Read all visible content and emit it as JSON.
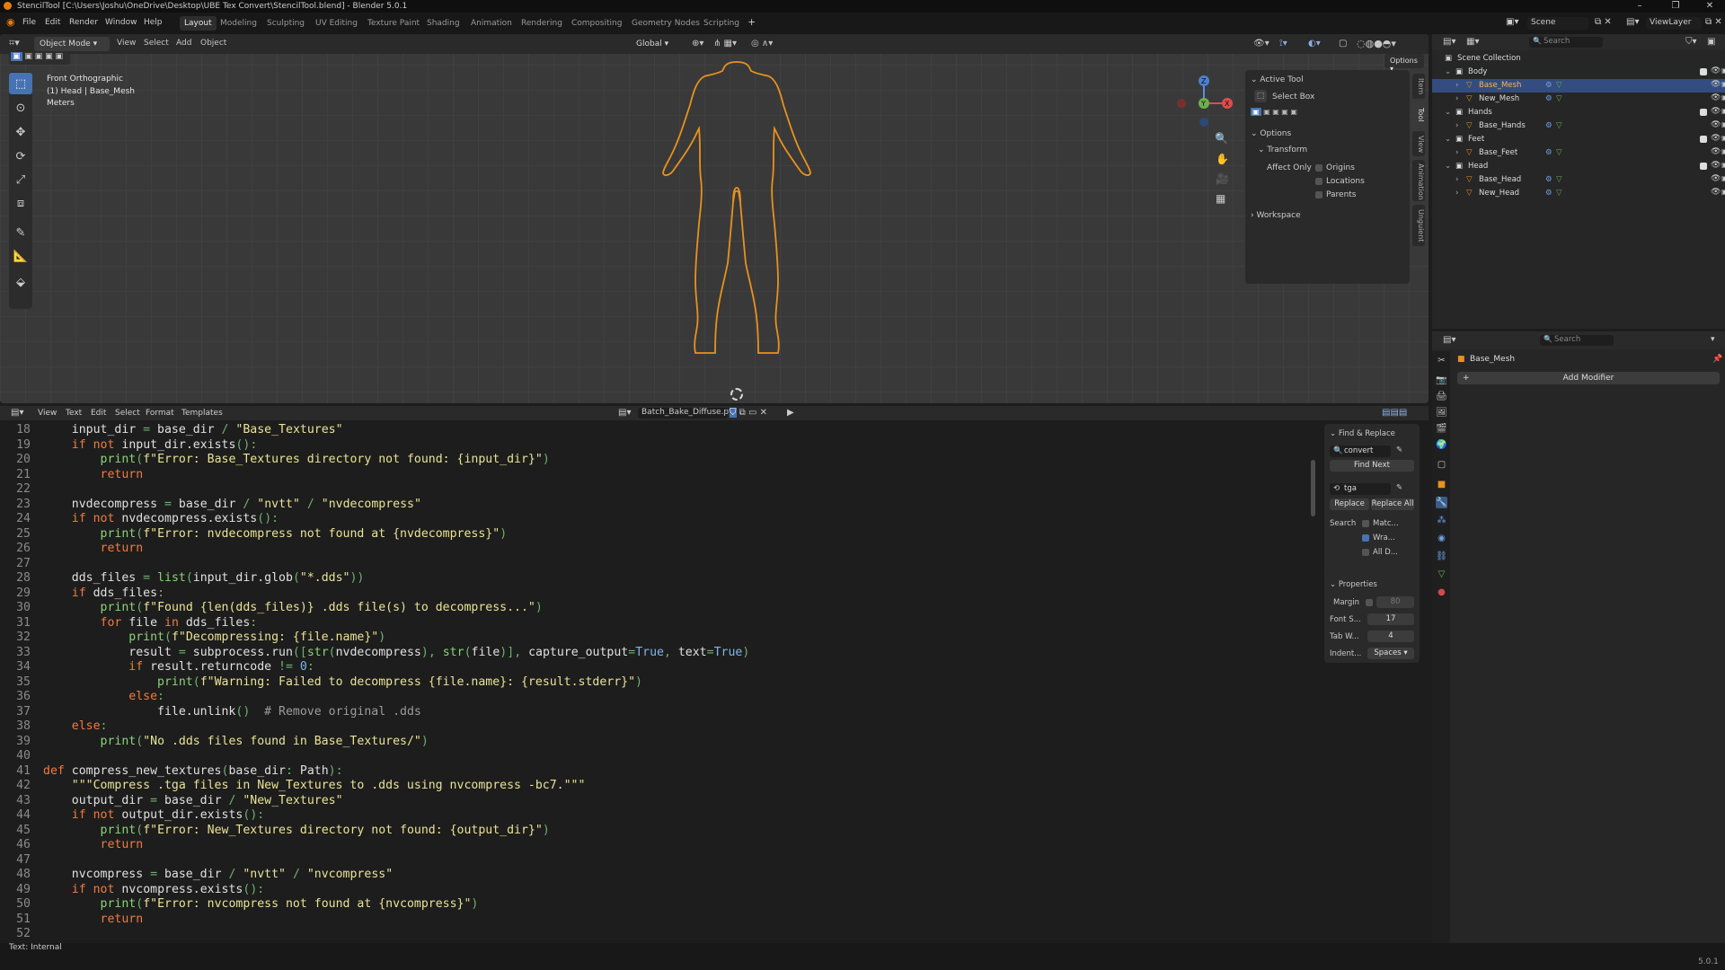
{
  "window": {
    "title": "StencilTool [C:\\Users\\Joshu\\OneDrive\\Desktop\\UBE Tex Convert\\StencilTool.blend] - Blender 5.0.1"
  },
  "menu": {
    "file": "File",
    "edit": "Edit",
    "render": "Render",
    "window": "Window",
    "help": "Help"
  },
  "workspaces": [
    "Layout",
    "Modeling",
    "Sculpting",
    "UV Editing",
    "Texture Paint",
    "Shading",
    "Animation",
    "Rendering",
    "Compositing",
    "Geometry Nodes",
    "Scripting"
  ],
  "scene": {
    "name": "Scene",
    "view_layer": "ViewLayer",
    "search_placeholder": "Search"
  },
  "viewport": {
    "mode": "Object Mode",
    "menus": [
      "View",
      "Select",
      "Add",
      "Object"
    ],
    "orientation": "Global",
    "options": "Options",
    "overlay": {
      "view": "Front Orthographic",
      "collection": "(1) Head | Base_Mesh",
      "units": "Meters"
    },
    "gizmo": {
      "z": "Z",
      "y": "Y",
      "x": "X"
    }
  },
  "npanel": {
    "active_tool": "Active Tool",
    "select_box": "Select Box",
    "options": "Options",
    "transform": "Transform",
    "affect_only": "Affect Only",
    "origins": "Origins",
    "locations": "Locations",
    "parents": "Parents",
    "workspace": "Workspace",
    "tabs": [
      "Item",
      "Tool",
      "View",
      "Animation",
      "Unguient"
    ]
  },
  "text_editor": {
    "menus": [
      "View",
      "Text",
      "Edit",
      "Select",
      "Format",
      "Templates"
    ],
    "filename": "Batch_Bake_Diffuse.py",
    "lines": [
      {
        "n": "18",
        "code": "    input_dir = base_dir / \"Base_Textures\""
      },
      {
        "n": "19",
        "code": "    if not input_dir.exists():"
      },
      {
        "n": "20",
        "code": "        print(f\"Error: Base_Textures directory not found: {input_dir}\")"
      },
      {
        "n": "21",
        "code": "        return"
      },
      {
        "n": "22",
        "code": ""
      },
      {
        "n": "23",
        "code": "    nvdecompress = base_dir / \"nvtt\" / \"nvdecompress\""
      },
      {
        "n": "24",
        "code": "    if not nvdecompress.exists():"
      },
      {
        "n": "25",
        "code": "        print(f\"Error: nvdecompress not found at {nvdecompress}\")"
      },
      {
        "n": "26",
        "code": "        return"
      },
      {
        "n": "27",
        "code": ""
      },
      {
        "n": "28",
        "code": "    dds_files = list(input_dir.glob(\"*.dds\"))"
      },
      {
        "n": "29",
        "code": "    if dds_files:"
      },
      {
        "n": "30",
        "code": "        print(f\"Found {len(dds_files)} .dds file(s) to decompress...\")"
      },
      {
        "n": "31",
        "code": "        for file in dds_files:"
      },
      {
        "n": "32",
        "code": "            print(f\"Decompressing: {file.name}\")"
      },
      {
        "n": "33",
        "code": "            result = subprocess.run([str(nvdecompress), str(file)], capture_output=True, text=True)"
      },
      {
        "n": "34",
        "code": "            if result.returncode != 0:"
      },
      {
        "n": "35",
        "code": "                print(f\"Warning: Failed to decompress {file.name}: {result.stderr}\")"
      },
      {
        "n": "36",
        "code": "            else:"
      },
      {
        "n": "37",
        "code": "                file.unlink()  # Remove original .dds"
      },
      {
        "n": "38",
        "code": "    else:"
      },
      {
        "n": "39",
        "code": "        print(\"No .dds files found in Base_Textures/\")"
      },
      {
        "n": "40",
        "code": ""
      },
      {
        "n": "41",
        "code": "def compress_new_textures(base_dir: Path):"
      },
      {
        "n": "42",
        "code": "    \"\"\"Compress .tga files in New_Textures to .dds using nvcompress -bc7.\"\"\""
      },
      {
        "n": "43",
        "code": "    output_dir = base_dir / \"New_Textures\""
      },
      {
        "n": "44",
        "code": "    if not output_dir.exists():"
      },
      {
        "n": "45",
        "code": "        print(f\"Error: New_Textures directory not found: {output_dir}\")"
      },
      {
        "n": "46",
        "code": "        return"
      },
      {
        "n": "47",
        "code": ""
      },
      {
        "n": "48",
        "code": "    nvcompress = base_dir / \"nvtt\" / \"nvcompress\""
      },
      {
        "n": "49",
        "code": "    if not nvcompress.exists():"
      },
      {
        "n": "50",
        "code": "        print(f\"Error: nvcompress not found at {nvcompress}\")"
      },
      {
        "n": "51",
        "code": "        return"
      },
      {
        "n": "52",
        "code": ""
      }
    ],
    "find_replace": {
      "title": "Find & Replace",
      "find_value": "convert",
      "find_next": "Find Next",
      "replace_value": "tga",
      "replace": "Replace",
      "replace_all": "Replace All",
      "search": "Search",
      "match": "Matc...",
      "wrap": "Wra...",
      "all": "All D..."
    },
    "properties": {
      "title": "Properties",
      "margin": "Margin",
      "margin_value": "80",
      "font_size": "Font S...",
      "font_size_value": "17",
      "tab_width": "Tab W...",
      "tab_width_value": "4",
      "indent": "Indent...",
      "indent_value": "Spaces"
    }
  },
  "outliner": {
    "search_placeholder": "Search",
    "scene_collection": "Scene Collection",
    "rows": [
      {
        "name": "Body",
        "type": "collection"
      },
      {
        "name": "Base_Mesh",
        "type": "mesh",
        "selected": true
      },
      {
        "name": "New_Mesh",
        "type": "mesh"
      },
      {
        "name": "Hands",
        "type": "collection"
      },
      {
        "name": "Base_Hands",
        "type": "mesh"
      },
      {
        "name": "Feet",
        "type": "collection"
      },
      {
        "name": "Base_Feet",
        "type": "mesh"
      },
      {
        "name": "Head",
        "type": "collection"
      },
      {
        "name": "Base_Head",
        "type": "mesh"
      },
      {
        "name": "New_Head",
        "type": "mesh"
      }
    ]
  },
  "properties_editor": {
    "search_placeholder": "Search",
    "object_name": "Base_Mesh",
    "add_modifier": "Add Modifier"
  },
  "status": {
    "left": "Text: Internal",
    "version": "5.0.1"
  },
  "colors": {
    "accent": "#4772b3",
    "selection_outline": "#e8921d",
    "header": "#2a2a2a",
    "viewport": "#393939"
  }
}
